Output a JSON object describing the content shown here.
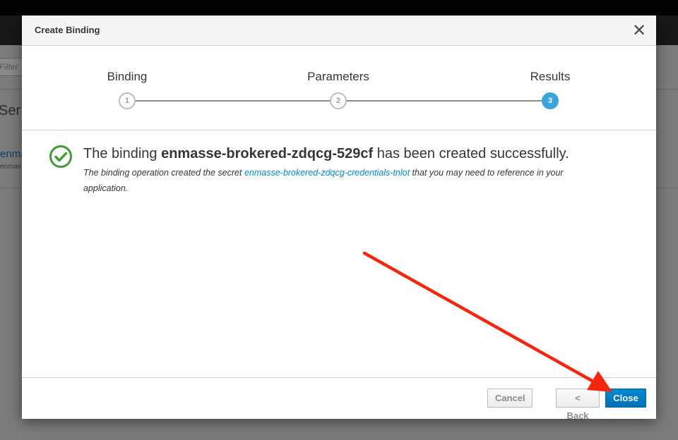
{
  "background": {
    "filter_placeholder": "Filter by",
    "section_title": "Services",
    "item_link": "enmasse (",
    "item_sub": "enmasse-brokered"
  },
  "modal": {
    "title": "Create Binding",
    "close_icon": "close-icon"
  },
  "wizard": {
    "steps": [
      {
        "label": "Binding",
        "number": "1",
        "state": "completed"
      },
      {
        "label": "Parameters",
        "number": "2",
        "state": "completed"
      },
      {
        "label": "Results",
        "number": "3",
        "state": "active"
      }
    ]
  },
  "result": {
    "icon": "success-check-icon",
    "title_prefix": "The binding ",
    "binding_name": "enmasse-brokered-zdqcg-529cf",
    "title_suffix": " has been created successfully.",
    "desc_prefix": "The binding operation created the secret ",
    "secret_link": "enmasse-brokered-zdqcg-credentials-tnlot",
    "desc_suffix": " that you may need to reference in your application."
  },
  "footer": {
    "cancel_label": "Cancel",
    "back_label": "< Back",
    "close_label": "Close"
  },
  "colors": {
    "primary": "#0088ce",
    "step_active": "#39a5dc",
    "success": "#3f9c35",
    "annotation_arrow": "#f5260f"
  }
}
